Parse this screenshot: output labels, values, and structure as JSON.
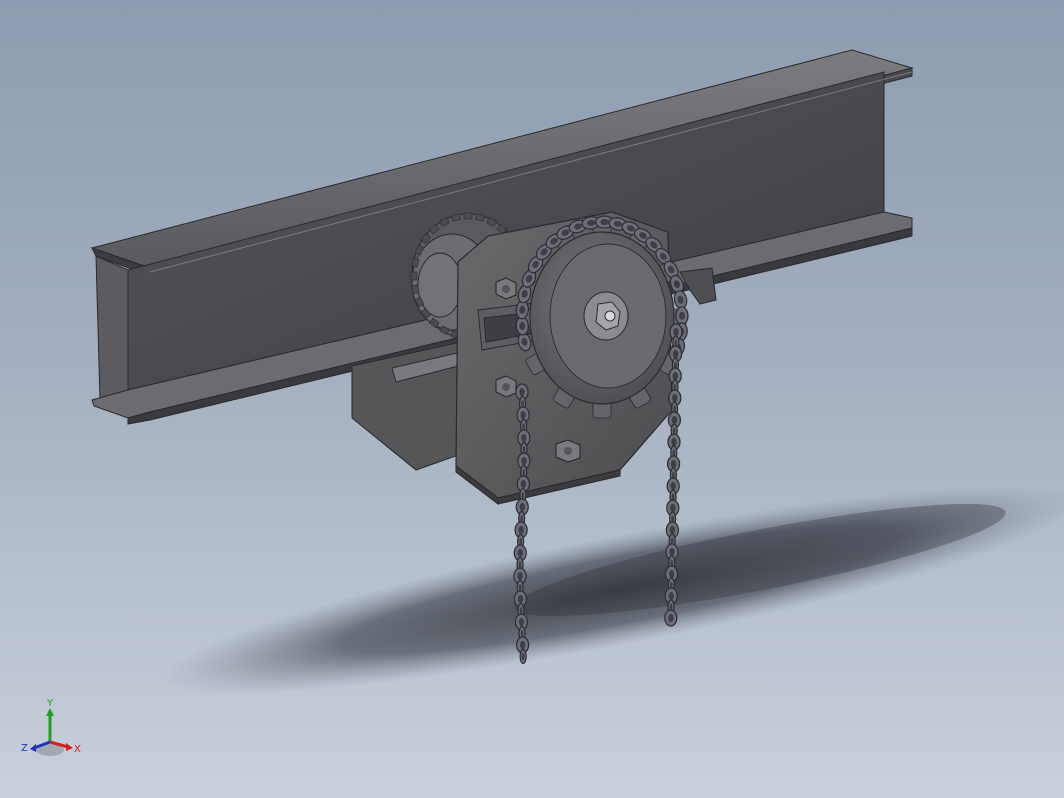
{
  "viewport": {
    "background_top": "#8d9cb0",
    "background_bottom": "#c9d0db"
  },
  "model": {
    "beam_color": "#4a4a4e",
    "trolley_color": "#5a5a5a",
    "sprocket_color": "#656569",
    "chain_color": "#6e6e78"
  },
  "triad": {
    "x_label": "X",
    "y_label": "Y",
    "z_label": "Z",
    "x_color": "#d22020",
    "y_color": "#20a020",
    "z_color": "#2030c0"
  }
}
